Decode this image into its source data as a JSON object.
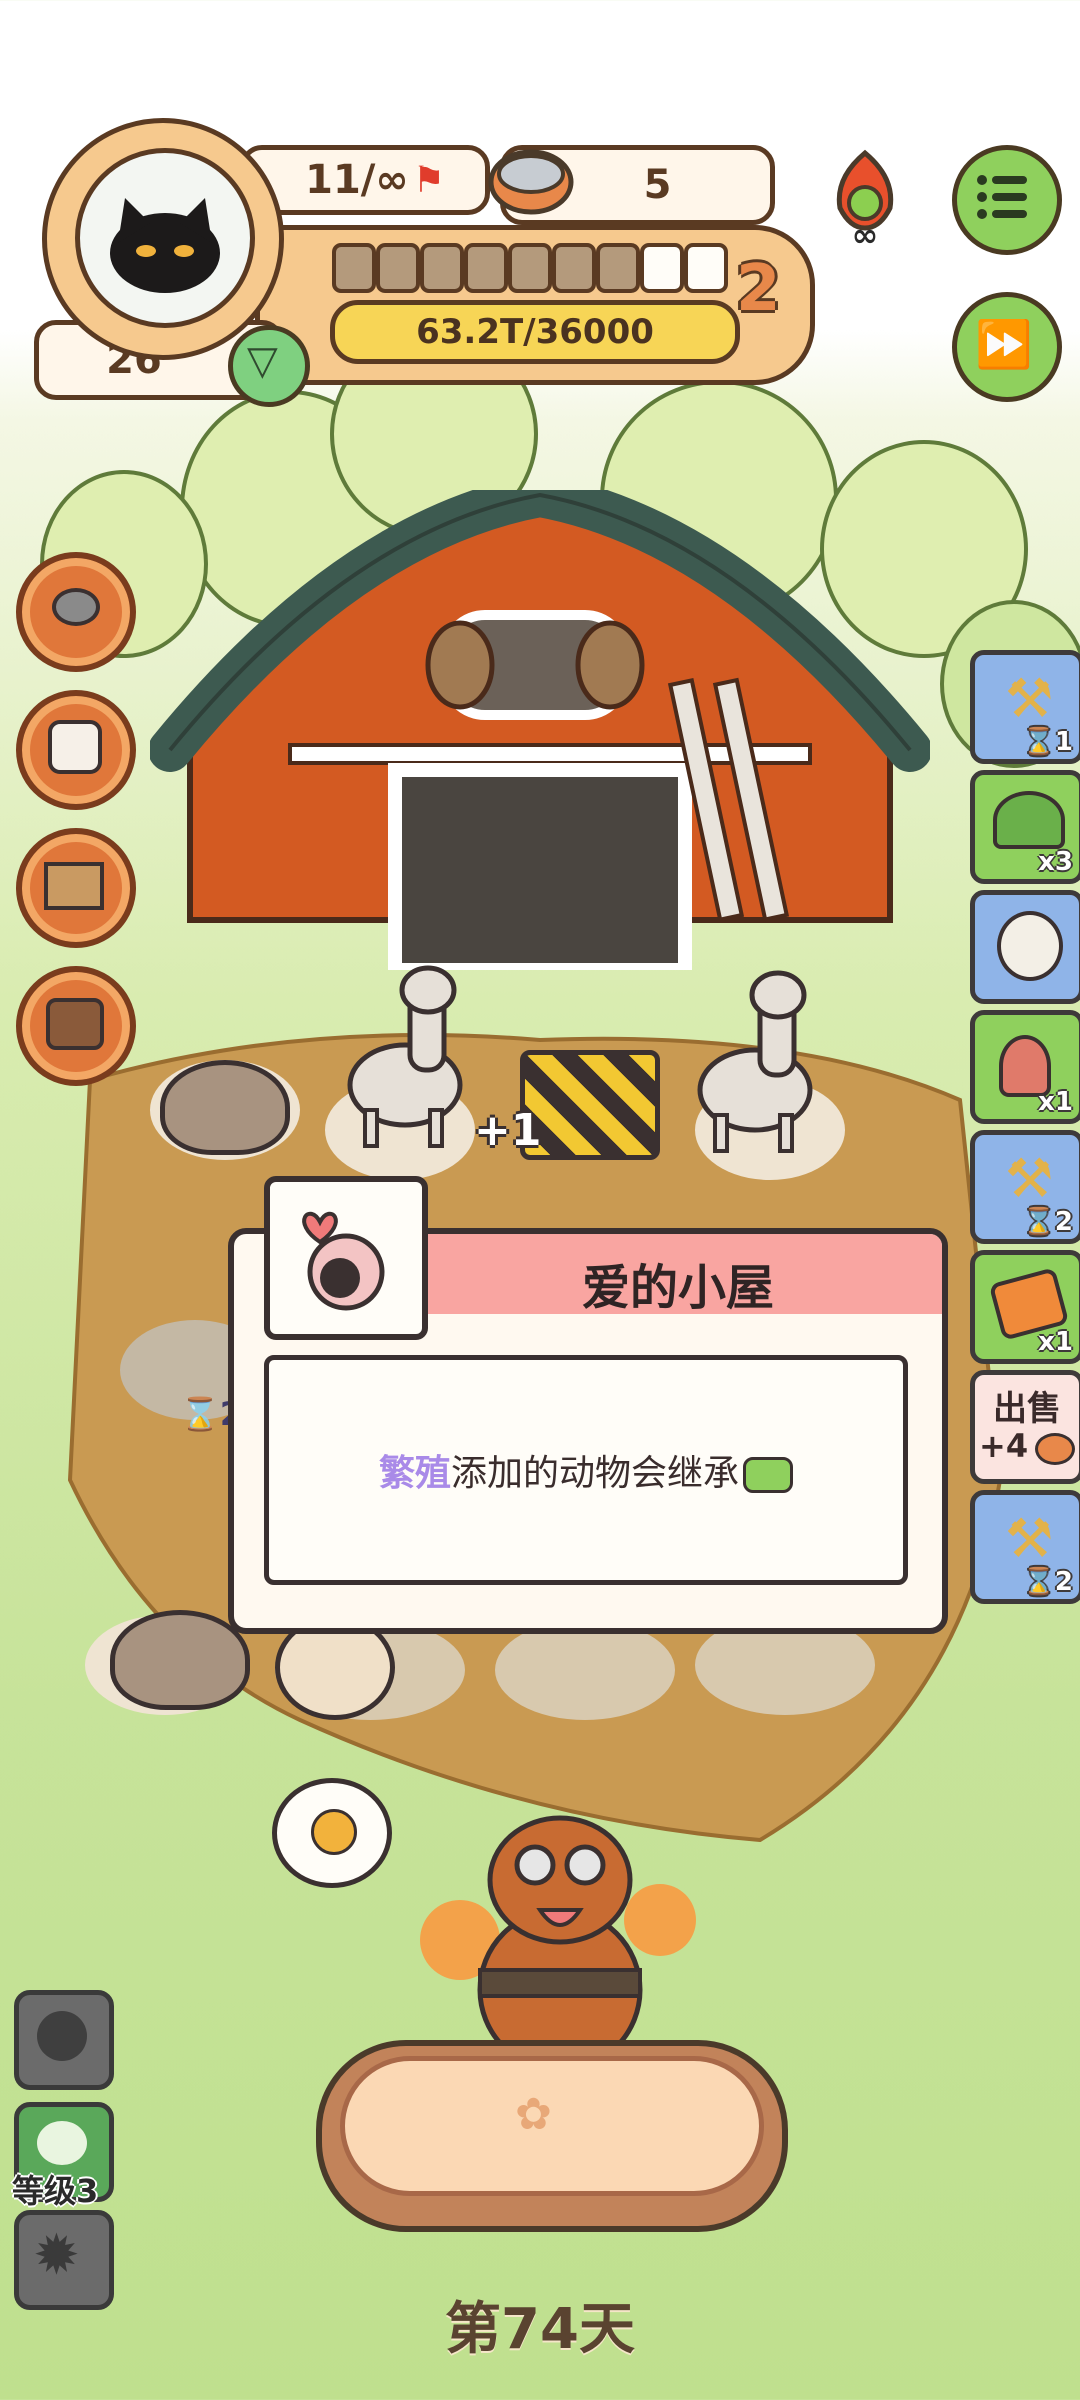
{
  "hud": {
    "level_count": "11/∞",
    "can_count": "5",
    "player_number": "26",
    "xp_text": "63.2T/36000",
    "level_badge": "2",
    "progress_segments_filled": 7,
    "progress_segments_total": 9
  },
  "right_cards": [
    {
      "name": "shovel-card",
      "badge": "⌛1",
      "color": "blue"
    },
    {
      "name": "tent-card",
      "badge": "x3",
      "color": "green"
    },
    {
      "name": "sheep-card",
      "badge": "",
      "color": "blue"
    },
    {
      "name": "mole-card",
      "badge": "x1",
      "color": "green"
    },
    {
      "name": "shovel-card",
      "badge": "⌛2",
      "color": "blue"
    },
    {
      "name": "ticket-card",
      "badge": "x1",
      "color": "green"
    },
    {
      "name": "sell-card",
      "badge": "",
      "color": "pink"
    },
    {
      "name": "shovel-card",
      "badge": "⌛2",
      "color": "blue"
    }
  ],
  "sell": {
    "label": "出售",
    "amount": "+4"
  },
  "field_labels": {
    "plus_one": "+1",
    "timer_two": "⌛2"
  },
  "dialog": {
    "title": "爱的小屋",
    "keyword": "繁殖",
    "text": "添加的动物会继承"
  },
  "bottom": {
    "level_label": "等级3",
    "day": "第74天"
  },
  "colors": {
    "orange": "#f6c98e",
    "header_pink": "#f9a5a1",
    "keyword_purple": "#a98ae8",
    "button_green": "#8fd05d"
  }
}
